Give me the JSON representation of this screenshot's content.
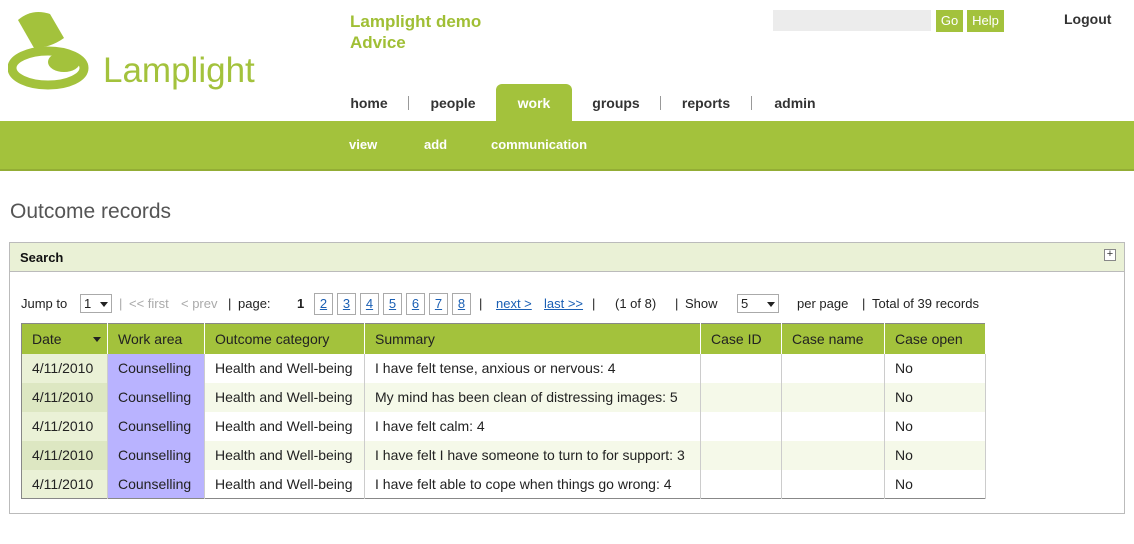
{
  "logo": {
    "text": "Lamplight"
  },
  "app": {
    "title_line1": "Lamplight demo",
    "title_line2": "Advice"
  },
  "header": {
    "search_placeholder": "",
    "go_label": "Go",
    "help_label": "Help",
    "logout_label": "Logout"
  },
  "nav": {
    "items": [
      {
        "label": "home"
      },
      {
        "label": "people"
      },
      {
        "label": "work",
        "active": true
      },
      {
        "label": "groups"
      },
      {
        "label": "reports"
      },
      {
        "label": "admin"
      }
    ]
  },
  "subnav": {
    "items": [
      {
        "label": "view"
      },
      {
        "label": "add"
      },
      {
        "label": "communication"
      }
    ]
  },
  "page": {
    "title": "Outcome records"
  },
  "search_panel": {
    "label": "Search",
    "expand_symbol": "+"
  },
  "pager": {
    "jump_to_label": "Jump to",
    "jump_to_value": "1",
    "first_label": "<< first",
    "prev_label": "< prev",
    "page_label": "page:",
    "current_page": "1",
    "pages": [
      "2",
      "3",
      "4",
      "5",
      "6",
      "7",
      "8"
    ],
    "next_label": "next >",
    "last_label": "last >>",
    "page_of": "(1 of 8)",
    "show_label": "Show",
    "show_value": "5",
    "per_page_label": "per page",
    "total_label": "Total of 39 records",
    "sep": "|"
  },
  "table": {
    "columns": [
      "Date",
      "Work area",
      "Outcome category",
      "Summary",
      "Case ID",
      "Case name",
      "Case open"
    ],
    "rows": [
      [
        "4/11/2010",
        "Counselling",
        "Health and Well-being",
        "I have felt tense, anxious or nervous: 4",
        "",
        "",
        "No"
      ],
      [
        "4/11/2010",
        "Counselling",
        "Health and Well-being",
        "My mind has been clean of distressing images: 5",
        "",
        "",
        "No"
      ],
      [
        "4/11/2010",
        "Counselling",
        "Health and Well-being",
        "I have felt calm: 4",
        "",
        "",
        "No"
      ],
      [
        "4/11/2010",
        "Counselling",
        "Health and Well-being",
        "I have felt I have someone to turn to for support: 3",
        "",
        "",
        "No"
      ],
      [
        "4/11/2010",
        "Counselling",
        "Health and Well-being",
        "I have felt able to cope when things go wrong: 4",
        "",
        "",
        "No"
      ]
    ]
  },
  "colors": {
    "brand_green": "#a3c23c",
    "work_area_purple": "#b9b3ff",
    "link_blue": "#1a5fb4"
  },
  "icons": {
    "logo": "lamp-logo-icon",
    "expand": "plus-box-icon",
    "sort": "caret-down-icon"
  }
}
